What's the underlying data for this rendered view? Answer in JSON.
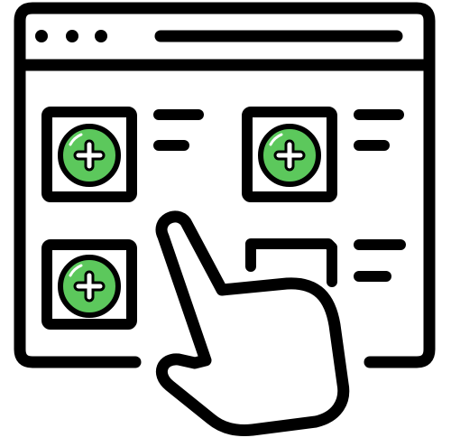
{
  "illustration": {
    "kind": "web-browser-add-items-icon",
    "colors": {
      "outline": "#000000",
      "background": "#ffffff",
      "add_fill": "#5cc85c",
      "add_plus": "#ffffff"
    },
    "window": {
      "dots": 3,
      "has_address_bar": true
    },
    "tiles": [
      {
        "name": "tile-top-left",
        "state": "add",
        "icon": "plus-circle-icon"
      },
      {
        "name": "tile-top-right",
        "state": "add",
        "icon": "plus-circle-icon"
      },
      {
        "name": "tile-bottom-left",
        "state": "add",
        "icon": "plus-circle-icon"
      },
      {
        "name": "tile-bottom-right",
        "state": "empty-placeholder",
        "icon": ""
      }
    ],
    "pointer": {
      "icon": "hand-pointer-icon"
    }
  }
}
